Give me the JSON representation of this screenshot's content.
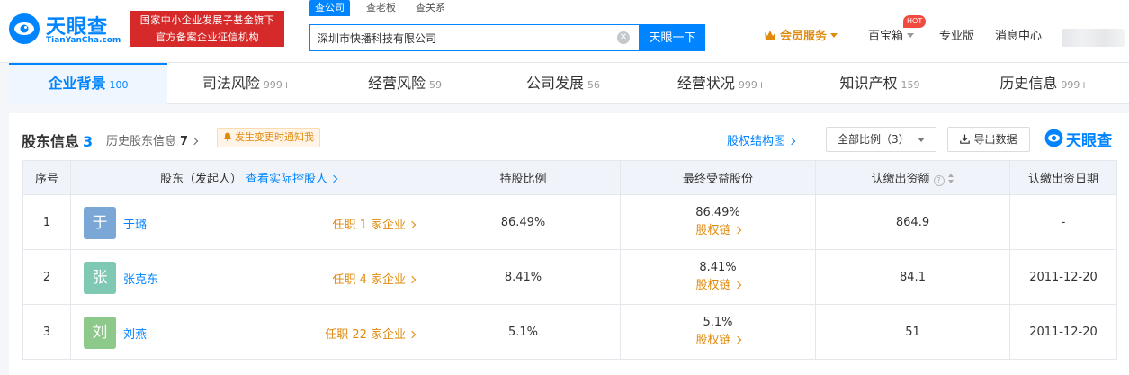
{
  "header": {
    "logo_cn": "天眼查",
    "logo_en": "TianYanCha.com",
    "gov_line1": "国家中小企业发展子基金旗下",
    "gov_line2": "官方备案企业征信机构",
    "search_tabs": [
      "查公司",
      "查老板",
      "查关系"
    ],
    "search_value": "深圳市快播科技有限公司",
    "search_button": "天眼一下",
    "member_service": "会员服务",
    "treasure_box": "百宝箱",
    "hot_badge": "HOT",
    "pro_version": "专业版",
    "message_center": "消息中心",
    "colors": {
      "brand": "#0084ff",
      "gov_red": "#d62a2a",
      "accent_orange": "#e08a0c"
    }
  },
  "tabs": [
    {
      "label": "企业背景",
      "count": "100",
      "active": true
    },
    {
      "label": "司法风险",
      "count": "999+"
    },
    {
      "label": "经营风险",
      "count": "59"
    },
    {
      "label": "公司发展",
      "count": "56"
    },
    {
      "label": "经营状况",
      "count": "999+"
    },
    {
      "label": "知识产权",
      "count": "159"
    },
    {
      "label": "历史信息",
      "count": "999+"
    }
  ],
  "section": {
    "title": "股东信息",
    "count": "3",
    "history_label": "历史股东信息",
    "history_count": "7",
    "notify_label": "发生变更时通知我",
    "structure_link": "股权结构图",
    "ratio_filter": "全部比例（3）",
    "export_label": "导出数据",
    "brand_label": "天眼查"
  },
  "table": {
    "headers": {
      "index": "序号",
      "holder": "股东（发起人）",
      "holder_link": "查看实际控股人",
      "ratio": "持股比例",
      "benefit": "最终受益股份",
      "capital": "认缴出资额",
      "date": "认缴出资日期"
    },
    "chain_label": "股权链",
    "rows": [
      {
        "index": "1",
        "avatar": "于",
        "avatar_color": "#7aa7d6",
        "name": "于璐",
        "positions": "任职 1 家企业",
        "ratio": "86.49%",
        "benefit": "86.49%",
        "capital": "864.9",
        "date": "-"
      },
      {
        "index": "2",
        "avatar": "张",
        "avatar_color": "#7fc8b4",
        "name": "张克东",
        "positions": "任职 4 家企业",
        "ratio": "8.41%",
        "benefit": "8.41%",
        "capital": "84.1",
        "date": "2011-12-20"
      },
      {
        "index": "3",
        "avatar": "刘",
        "avatar_color": "#8cc98a",
        "name": "刘燕",
        "positions": "任职 22 家企业",
        "ratio": "5.1%",
        "benefit": "5.1%",
        "capital": "51",
        "date": "2011-12-20"
      }
    ]
  }
}
